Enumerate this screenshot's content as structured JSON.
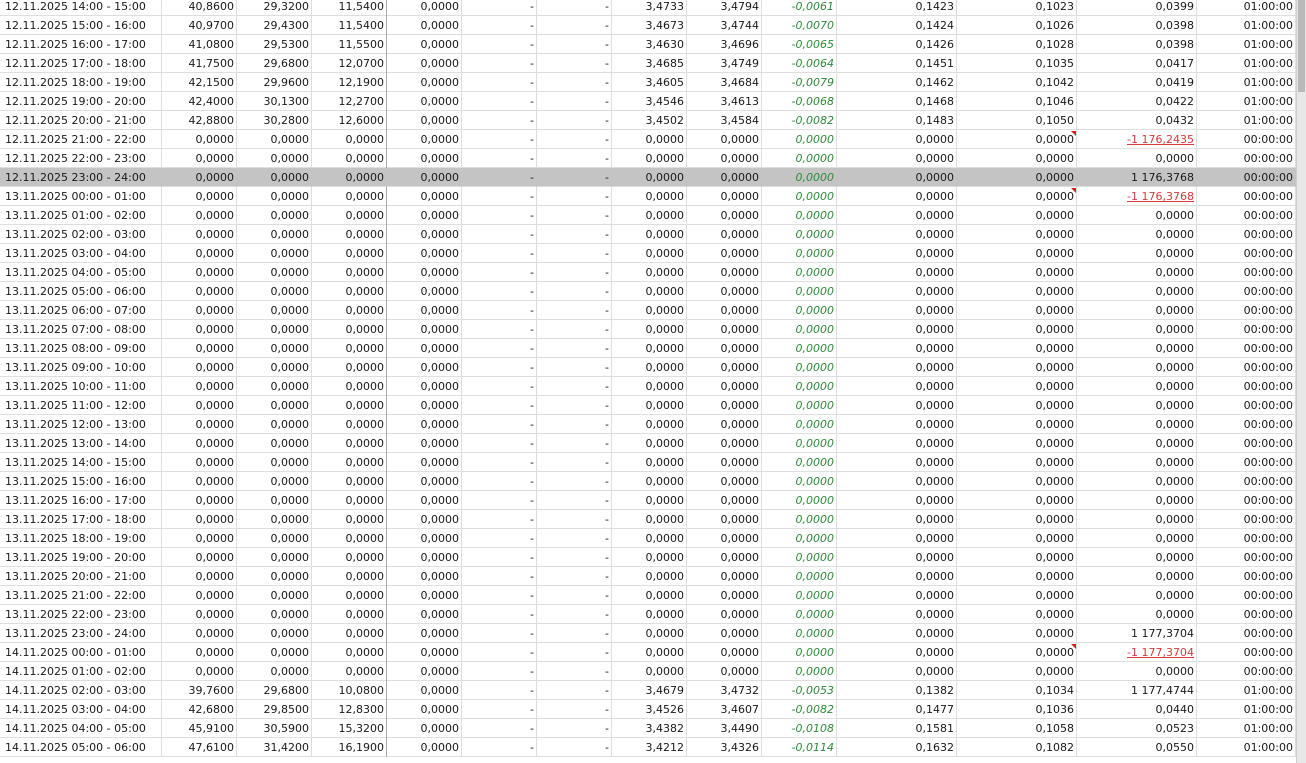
{
  "columns": [
    "period",
    "v1",
    "v2",
    "v3",
    "v4",
    "v5",
    "v6",
    "v7",
    "v8",
    "diff",
    "v10",
    "v11",
    "v12",
    "duration"
  ],
  "rows": [
    {
      "period": "12.11.2025 14:00 - 15:00",
      "v1": "40,8600",
      "v2": "29,3200",
      "v3": "11,5400",
      "v4": "0,0000",
      "v5": "-",
      "v6": "-",
      "v7": "3,4733",
      "v8": "3,4794",
      "diff": "-0,0061",
      "v10": "0,1423",
      "v11": "0,1023",
      "v12": "0,0399",
      "duration": "01:00:00"
    },
    {
      "period": "12.11.2025 15:00 - 16:00",
      "v1": "40,9700",
      "v2": "29,4300",
      "v3": "11,5400",
      "v4": "0,0000",
      "v5": "-",
      "v6": "-",
      "v7": "3,4673",
      "v8": "3,4744",
      "diff": "-0,0070",
      "v10": "0,1424",
      "v11": "0,1026",
      "v12": "0,0398",
      "duration": "01:00:00"
    },
    {
      "period": "12.11.2025 16:00 - 17:00",
      "v1": "41,0800",
      "v2": "29,5300",
      "v3": "11,5500",
      "v4": "0,0000",
      "v5": "-",
      "v6": "-",
      "v7": "3,4630",
      "v8": "3,4696",
      "diff": "-0,0065",
      "v10": "0,1426",
      "v11": "0,1028",
      "v12": "0,0398",
      "duration": "01:00:00"
    },
    {
      "period": "12.11.2025 17:00 - 18:00",
      "v1": "41,7500",
      "v2": "29,6800",
      "v3": "12,0700",
      "v4": "0,0000",
      "v5": "-",
      "v6": "-",
      "v7": "3,4685",
      "v8": "3,4749",
      "diff": "-0,0064",
      "v10": "0,1451",
      "v11": "0,1035",
      "v12": "0,0417",
      "duration": "01:00:00"
    },
    {
      "period": "12.11.2025 18:00 - 19:00",
      "v1": "42,1500",
      "v2": "29,9600",
      "v3": "12,1900",
      "v4": "0,0000",
      "v5": "-",
      "v6": "-",
      "v7": "3,4605",
      "v8": "3,4684",
      "diff": "-0,0079",
      "v10": "0,1462",
      "v11": "0,1042",
      "v12": "0,0419",
      "duration": "01:00:00"
    },
    {
      "period": "12.11.2025 19:00 - 20:00",
      "v1": "42,4000",
      "v2": "30,1300",
      "v3": "12,2700",
      "v4": "0,0000",
      "v5": "-",
      "v6": "-",
      "v7": "3,4546",
      "v8": "3,4613",
      "diff": "-0,0068",
      "v10": "0,1468",
      "v11": "0,1046",
      "v12": "0,0422",
      "duration": "01:00:00"
    },
    {
      "period": "12.11.2025 20:00 - 21:00",
      "v1": "42,8800",
      "v2": "30,2800",
      "v3": "12,6000",
      "v4": "0,0000",
      "v5": "-",
      "v6": "-",
      "v7": "3,4502",
      "v8": "3,4584",
      "diff": "-0,0082",
      "v10": "0,1483",
      "v11": "0,1050",
      "v12": "0,0432",
      "duration": "01:00:00"
    },
    {
      "period": "12.11.2025 21:00 - 22:00",
      "v1": "0,0000",
      "v2": "0,0000",
      "v3": "0,0000",
      "v4": "0,0000",
      "v5": "-",
      "v6": "-",
      "v7": "0,0000",
      "v8": "0,0000",
      "diff": "0,0000",
      "v10": "0,0000",
      "v11": "0,0000",
      "v12": "-1 176,2435",
      "duration": "00:00:00"
    },
    {
      "period": "12.11.2025 22:00 - 23:00",
      "v1": "0,0000",
      "v2": "0,0000",
      "v3": "0,0000",
      "v4": "0,0000",
      "v5": "-",
      "v6": "-",
      "v7": "0,0000",
      "v8": "0,0000",
      "diff": "0,0000",
      "v10": "0,0000",
      "v11": "0,0000",
      "v12": "0,0000",
      "duration": "00:00:00"
    },
    {
      "period": "12.11.2025 23:00 - 24:00",
      "v1": "0,0000",
      "v2": "0,0000",
      "v3": "0,0000",
      "v4": "0,0000",
      "v5": "-",
      "v6": "-",
      "v7": "0,0000",
      "v8": "0,0000",
      "diff": "0,0000",
      "v10": "0,0000",
      "v11": "0,0000",
      "v12": "1 176,3768",
      "duration": "00:00:00"
    },
    {
      "period": "13.11.2025 00:00 - 01:00",
      "v1": "0,0000",
      "v2": "0,0000",
      "v3": "0,0000",
      "v4": "0,0000",
      "v5": "-",
      "v6": "-",
      "v7": "0,0000",
      "v8": "0,0000",
      "diff": "0,0000",
      "v10": "0,0000",
      "v11": "0,0000",
      "v12": "-1 176,3768",
      "duration": "00:00:00"
    },
    {
      "period": "13.11.2025 01:00 - 02:00",
      "v1": "0,0000",
      "v2": "0,0000",
      "v3": "0,0000",
      "v4": "0,0000",
      "v5": "-",
      "v6": "-",
      "v7": "0,0000",
      "v8": "0,0000",
      "diff": "0,0000",
      "v10": "0,0000",
      "v11": "0,0000",
      "v12": "0,0000",
      "duration": "00:00:00"
    },
    {
      "period": "13.11.2025 02:00 - 03:00",
      "v1": "0,0000",
      "v2": "0,0000",
      "v3": "0,0000",
      "v4": "0,0000",
      "v5": "-",
      "v6": "-",
      "v7": "0,0000",
      "v8": "0,0000",
      "diff": "0,0000",
      "v10": "0,0000",
      "v11": "0,0000",
      "v12": "0,0000",
      "duration": "00:00:00"
    },
    {
      "period": "13.11.2025 03:00 - 04:00",
      "v1": "0,0000",
      "v2": "0,0000",
      "v3": "0,0000",
      "v4": "0,0000",
      "v5": "-",
      "v6": "-",
      "v7": "0,0000",
      "v8": "0,0000",
      "diff": "0,0000",
      "v10": "0,0000",
      "v11": "0,0000",
      "v12": "0,0000",
      "duration": "00:00:00"
    },
    {
      "period": "13.11.2025 04:00 - 05:00",
      "v1": "0,0000",
      "v2": "0,0000",
      "v3": "0,0000",
      "v4": "0,0000",
      "v5": "-",
      "v6": "-",
      "v7": "0,0000",
      "v8": "0,0000",
      "diff": "0,0000",
      "v10": "0,0000",
      "v11": "0,0000",
      "v12": "0,0000",
      "duration": "00:00:00"
    },
    {
      "period": "13.11.2025 05:00 - 06:00",
      "v1": "0,0000",
      "v2": "0,0000",
      "v3": "0,0000",
      "v4": "0,0000",
      "v5": "-",
      "v6": "-",
      "v7": "0,0000",
      "v8": "0,0000",
      "diff": "0,0000",
      "v10": "0,0000",
      "v11": "0,0000",
      "v12": "0,0000",
      "duration": "00:00:00"
    },
    {
      "period": "13.11.2025 06:00 - 07:00",
      "v1": "0,0000",
      "v2": "0,0000",
      "v3": "0,0000",
      "v4": "0,0000",
      "v5": "-",
      "v6": "-",
      "v7": "0,0000",
      "v8": "0,0000",
      "diff": "0,0000",
      "v10": "0,0000",
      "v11": "0,0000",
      "v12": "0,0000",
      "duration": "00:00:00"
    },
    {
      "period": "13.11.2025 07:00 - 08:00",
      "v1": "0,0000",
      "v2": "0,0000",
      "v3": "0,0000",
      "v4": "0,0000",
      "v5": "-",
      "v6": "-",
      "v7": "0,0000",
      "v8": "0,0000",
      "diff": "0,0000",
      "v10": "0,0000",
      "v11": "0,0000",
      "v12": "0,0000",
      "duration": "00:00:00"
    },
    {
      "period": "13.11.2025 08:00 - 09:00",
      "v1": "0,0000",
      "v2": "0,0000",
      "v3": "0,0000",
      "v4": "0,0000",
      "v5": "-",
      "v6": "-",
      "v7": "0,0000",
      "v8": "0,0000",
      "diff": "0,0000",
      "v10": "0,0000",
      "v11": "0,0000",
      "v12": "0,0000",
      "duration": "00:00:00"
    },
    {
      "period": "13.11.2025 09:00 - 10:00",
      "v1": "0,0000",
      "v2": "0,0000",
      "v3": "0,0000",
      "v4": "0,0000",
      "v5": "-",
      "v6": "-",
      "v7": "0,0000",
      "v8": "0,0000",
      "diff": "0,0000",
      "v10": "0,0000",
      "v11": "0,0000",
      "v12": "0,0000",
      "duration": "00:00:00"
    },
    {
      "period": "13.11.2025 10:00 - 11:00",
      "v1": "0,0000",
      "v2": "0,0000",
      "v3": "0,0000",
      "v4": "0,0000",
      "v5": "-",
      "v6": "-",
      "v7": "0,0000",
      "v8": "0,0000",
      "diff": "0,0000",
      "v10": "0,0000",
      "v11": "0,0000",
      "v12": "0,0000",
      "duration": "00:00:00"
    },
    {
      "period": "13.11.2025 11:00 - 12:00",
      "v1": "0,0000",
      "v2": "0,0000",
      "v3": "0,0000",
      "v4": "0,0000",
      "v5": "-",
      "v6": "-",
      "v7": "0,0000",
      "v8": "0,0000",
      "diff": "0,0000",
      "v10": "0,0000",
      "v11": "0,0000",
      "v12": "0,0000",
      "duration": "00:00:00"
    },
    {
      "period": "13.11.2025 12:00 - 13:00",
      "v1": "0,0000",
      "v2": "0,0000",
      "v3": "0,0000",
      "v4": "0,0000",
      "v5": "-",
      "v6": "-",
      "v7": "0,0000",
      "v8": "0,0000",
      "diff": "0,0000",
      "v10": "0,0000",
      "v11": "0,0000",
      "v12": "0,0000",
      "duration": "00:00:00"
    },
    {
      "period": "13.11.2025 13:00 - 14:00",
      "v1": "0,0000",
      "v2": "0,0000",
      "v3": "0,0000",
      "v4": "0,0000",
      "v5": "-",
      "v6": "-",
      "v7": "0,0000",
      "v8": "0,0000",
      "diff": "0,0000",
      "v10": "0,0000",
      "v11": "0,0000",
      "v12": "0,0000",
      "duration": "00:00:00"
    },
    {
      "period": "13.11.2025 14:00 - 15:00",
      "v1": "0,0000",
      "v2": "0,0000",
      "v3": "0,0000",
      "v4": "0,0000",
      "v5": "-",
      "v6": "-",
      "v7": "0,0000",
      "v8": "0,0000",
      "diff": "0,0000",
      "v10": "0,0000",
      "v11": "0,0000",
      "v12": "0,0000",
      "duration": "00:00:00"
    },
    {
      "period": "13.11.2025 15:00 - 16:00",
      "v1": "0,0000",
      "v2": "0,0000",
      "v3": "0,0000",
      "v4": "0,0000",
      "v5": "-",
      "v6": "-",
      "v7": "0,0000",
      "v8": "0,0000",
      "diff": "0,0000",
      "v10": "0,0000",
      "v11": "0,0000",
      "v12": "0,0000",
      "duration": "00:00:00"
    },
    {
      "period": "13.11.2025 16:00 - 17:00",
      "v1": "0,0000",
      "v2": "0,0000",
      "v3": "0,0000",
      "v4": "0,0000",
      "v5": "-",
      "v6": "-",
      "v7": "0,0000",
      "v8": "0,0000",
      "diff": "0,0000",
      "v10": "0,0000",
      "v11": "0,0000",
      "v12": "0,0000",
      "duration": "00:00:00"
    },
    {
      "period": "13.11.2025 17:00 - 18:00",
      "v1": "0,0000",
      "v2": "0,0000",
      "v3": "0,0000",
      "v4": "0,0000",
      "v5": "-",
      "v6": "-",
      "v7": "0,0000",
      "v8": "0,0000",
      "diff": "0,0000",
      "v10": "0,0000",
      "v11": "0,0000",
      "v12": "0,0000",
      "duration": "00:00:00"
    },
    {
      "period": "13.11.2025 18:00 - 19:00",
      "v1": "0,0000",
      "v2": "0,0000",
      "v3": "0,0000",
      "v4": "0,0000",
      "v5": "-",
      "v6": "-",
      "v7": "0,0000",
      "v8": "0,0000",
      "diff": "0,0000",
      "v10": "0,0000",
      "v11": "0,0000",
      "v12": "0,0000",
      "duration": "00:00:00"
    },
    {
      "period": "13.11.2025 19:00 - 20:00",
      "v1": "0,0000",
      "v2": "0,0000",
      "v3": "0,0000",
      "v4": "0,0000",
      "v5": "-",
      "v6": "-",
      "v7": "0,0000",
      "v8": "0,0000",
      "diff": "0,0000",
      "v10": "0,0000",
      "v11": "0,0000",
      "v12": "0,0000",
      "duration": "00:00:00"
    },
    {
      "period": "13.11.2025 20:00 - 21:00",
      "v1": "0,0000",
      "v2": "0,0000",
      "v3": "0,0000",
      "v4": "0,0000",
      "v5": "-",
      "v6": "-",
      "v7": "0,0000",
      "v8": "0,0000",
      "diff": "0,0000",
      "v10": "0,0000",
      "v11": "0,0000",
      "v12": "0,0000",
      "duration": "00:00:00"
    },
    {
      "period": "13.11.2025 21:00 - 22:00",
      "v1": "0,0000",
      "v2": "0,0000",
      "v3": "0,0000",
      "v4": "0,0000",
      "v5": "-",
      "v6": "-",
      "v7": "0,0000",
      "v8": "0,0000",
      "diff": "0,0000",
      "v10": "0,0000",
      "v11": "0,0000",
      "v12": "0,0000",
      "duration": "00:00:00"
    },
    {
      "period": "13.11.2025 22:00 - 23:00",
      "v1": "0,0000",
      "v2": "0,0000",
      "v3": "0,0000",
      "v4": "0,0000",
      "v5": "-",
      "v6": "-",
      "v7": "0,0000",
      "v8": "0,0000",
      "diff": "0,0000",
      "v10": "0,0000",
      "v11": "0,0000",
      "v12": "0,0000",
      "duration": "00:00:00"
    },
    {
      "period": "13.11.2025 23:00 - 24:00",
      "v1": "0,0000",
      "v2": "0,0000",
      "v3": "0,0000",
      "v4": "0,0000",
      "v5": "-",
      "v6": "-",
      "v7": "0,0000",
      "v8": "0,0000",
      "diff": "0,0000",
      "v10": "0,0000",
      "v11": "0,0000",
      "v12": "1 177,3704",
      "duration": "00:00:00"
    },
    {
      "period": "14.11.2025 00:00 - 01:00",
      "v1": "0,0000",
      "v2": "0,0000",
      "v3": "0,0000",
      "v4": "0,0000",
      "v5": "-",
      "v6": "-",
      "v7": "0,0000",
      "v8": "0,0000",
      "diff": "0,0000",
      "v10": "0,0000",
      "v11": "0,0000",
      "v12": "-1 177,3704",
      "duration": "00:00:00"
    },
    {
      "period": "14.11.2025 01:00 - 02:00",
      "v1": "0,0000",
      "v2": "0,0000",
      "v3": "0,0000",
      "v4": "0,0000",
      "v5": "-",
      "v6": "-",
      "v7": "0,0000",
      "v8": "0,0000",
      "diff": "0,0000",
      "v10": "0,0000",
      "v11": "0,0000",
      "v12": "0,0000",
      "duration": "00:00:00"
    },
    {
      "period": "14.11.2025 02:00 - 03:00",
      "v1": "39,7600",
      "v2": "29,6800",
      "v3": "10,0800",
      "v4": "0,0000",
      "v5": "-",
      "v6": "-",
      "v7": "3,4679",
      "v8": "3,4732",
      "diff": "-0,0053",
      "v10": "0,1382",
      "v11": "0,1034",
      "v12": "1 177,4744",
      "duration": "01:00:00"
    },
    {
      "period": "14.11.2025 03:00 - 04:00",
      "v1": "42,6800",
      "v2": "29,8500",
      "v3": "12,8300",
      "v4": "0,0000",
      "v5": "-",
      "v6": "-",
      "v7": "3,4526",
      "v8": "3,4607",
      "diff": "-0,0082",
      "v10": "0,1477",
      "v11": "0,1036",
      "v12": "0,0440",
      "duration": "01:00:00"
    },
    {
      "period": "14.11.2025 04:00 - 05:00",
      "v1": "45,9100",
      "v2": "30,5900",
      "v3": "15,3200",
      "v4": "0,0000",
      "v5": "-",
      "v6": "-",
      "v7": "3,4382",
      "v8": "3,4490",
      "diff": "-0,0108",
      "v10": "0,1581",
      "v11": "0,1058",
      "v12": "0,0523",
      "duration": "01:00:00"
    },
    {
      "period": "14.11.2025 05:00 - 06:00",
      "v1": "47,6100",
      "v2": "31,4200",
      "v3": "16,1900",
      "v4": "0,0000",
      "v5": "-",
      "v6": "-",
      "v7": "3,4212",
      "v8": "3,4326",
      "diff": "-0,0114",
      "v10": "0,1632",
      "v11": "0,1082",
      "v12": "0,0550",
      "duration": "01:00:00"
    }
  ],
  "selected_row": 9,
  "flagged_cells": [
    {
      "row": 7,
      "col": "v11"
    },
    {
      "row": 10,
      "col": "v11"
    },
    {
      "row": 34,
      "col": "v11"
    }
  ],
  "negative_highlight_cells": [
    {
      "row": 7,
      "col": "v12"
    },
    {
      "row": 10,
      "col": "v12"
    },
    {
      "row": 34,
      "col": "v12"
    }
  ],
  "colors": {
    "diff_text": "#2e8b3a",
    "negative_text": "#d63a3a",
    "selected_row": "#c4c4c4",
    "flag": "#d02020"
  },
  "scrollbar": {
    "position_fraction": 0.0,
    "visible_fraction": 0.12
  }
}
